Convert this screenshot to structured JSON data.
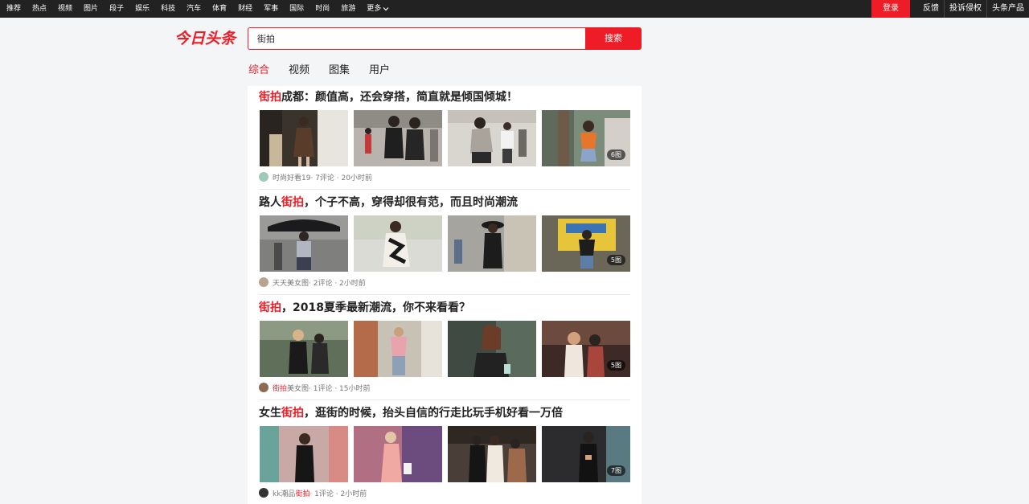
{
  "topnav": {
    "items": [
      "推荐",
      "热点",
      "视频",
      "图片",
      "段子",
      "娱乐",
      "科技",
      "汽车",
      "体育",
      "财经",
      "军事",
      "国际",
      "时尚",
      "旅游",
      "更多"
    ],
    "login": "登录",
    "links": [
      "反馈",
      "投诉侵权",
      "头条产品"
    ]
  },
  "logo": "今日头条",
  "search": {
    "value": "街拍",
    "button": "搜索"
  },
  "tabs": [
    "综合",
    "视频",
    "图集",
    "用户"
  ],
  "articles": [
    {
      "title_parts": [
        "街拍",
        "成都：颜值高，还会穿搭，简直就是倾国倾城！"
      ],
      "image_count": "6图",
      "meta_pre": "",
      "meta_hl": "",
      "meta_name": "时尚好看19",
      "meta_rest": " · 7评论 · 20小时前",
      "avatar_color": "#9fc9b8"
    },
    {
      "title_parts": [
        "路人",
        "街拍",
        "，个子不高，穿得却很有范，而且时尚潮流"
      ],
      "image_count": "5图",
      "meta_pre": "",
      "meta_hl": "",
      "meta_name": "天天美女图",
      "meta_rest": " · 2评论 · 2小时前",
      "avatar_color": "#b8a48f"
    },
    {
      "title_parts": [
        "街拍",
        "，2018夏季最新潮流，你不来看看？"
      ],
      "image_count": "5图",
      "meta_pre": "",
      "meta_hl": "街拍",
      "meta_name": "美女图",
      "meta_rest": " · 1评论 · 15小时前",
      "avatar_color": "#8a6a55"
    },
    {
      "title_parts": [
        "女生",
        "街拍",
        "，逛街的时候，抬头自信的行走比玩手机好看一万倍"
      ],
      "image_count": "7图",
      "meta_pre": "kk潮品",
      "meta_hl": "街拍",
      "meta_name": "",
      "meta_rest": " · 1评论 · 2小时前",
      "avatar_color": "#333333"
    }
  ],
  "colors": {
    "accent": "#ed1c26",
    "topbar": "#222222"
  },
  "icons": {
    "more": "chevron-down-icon"
  }
}
